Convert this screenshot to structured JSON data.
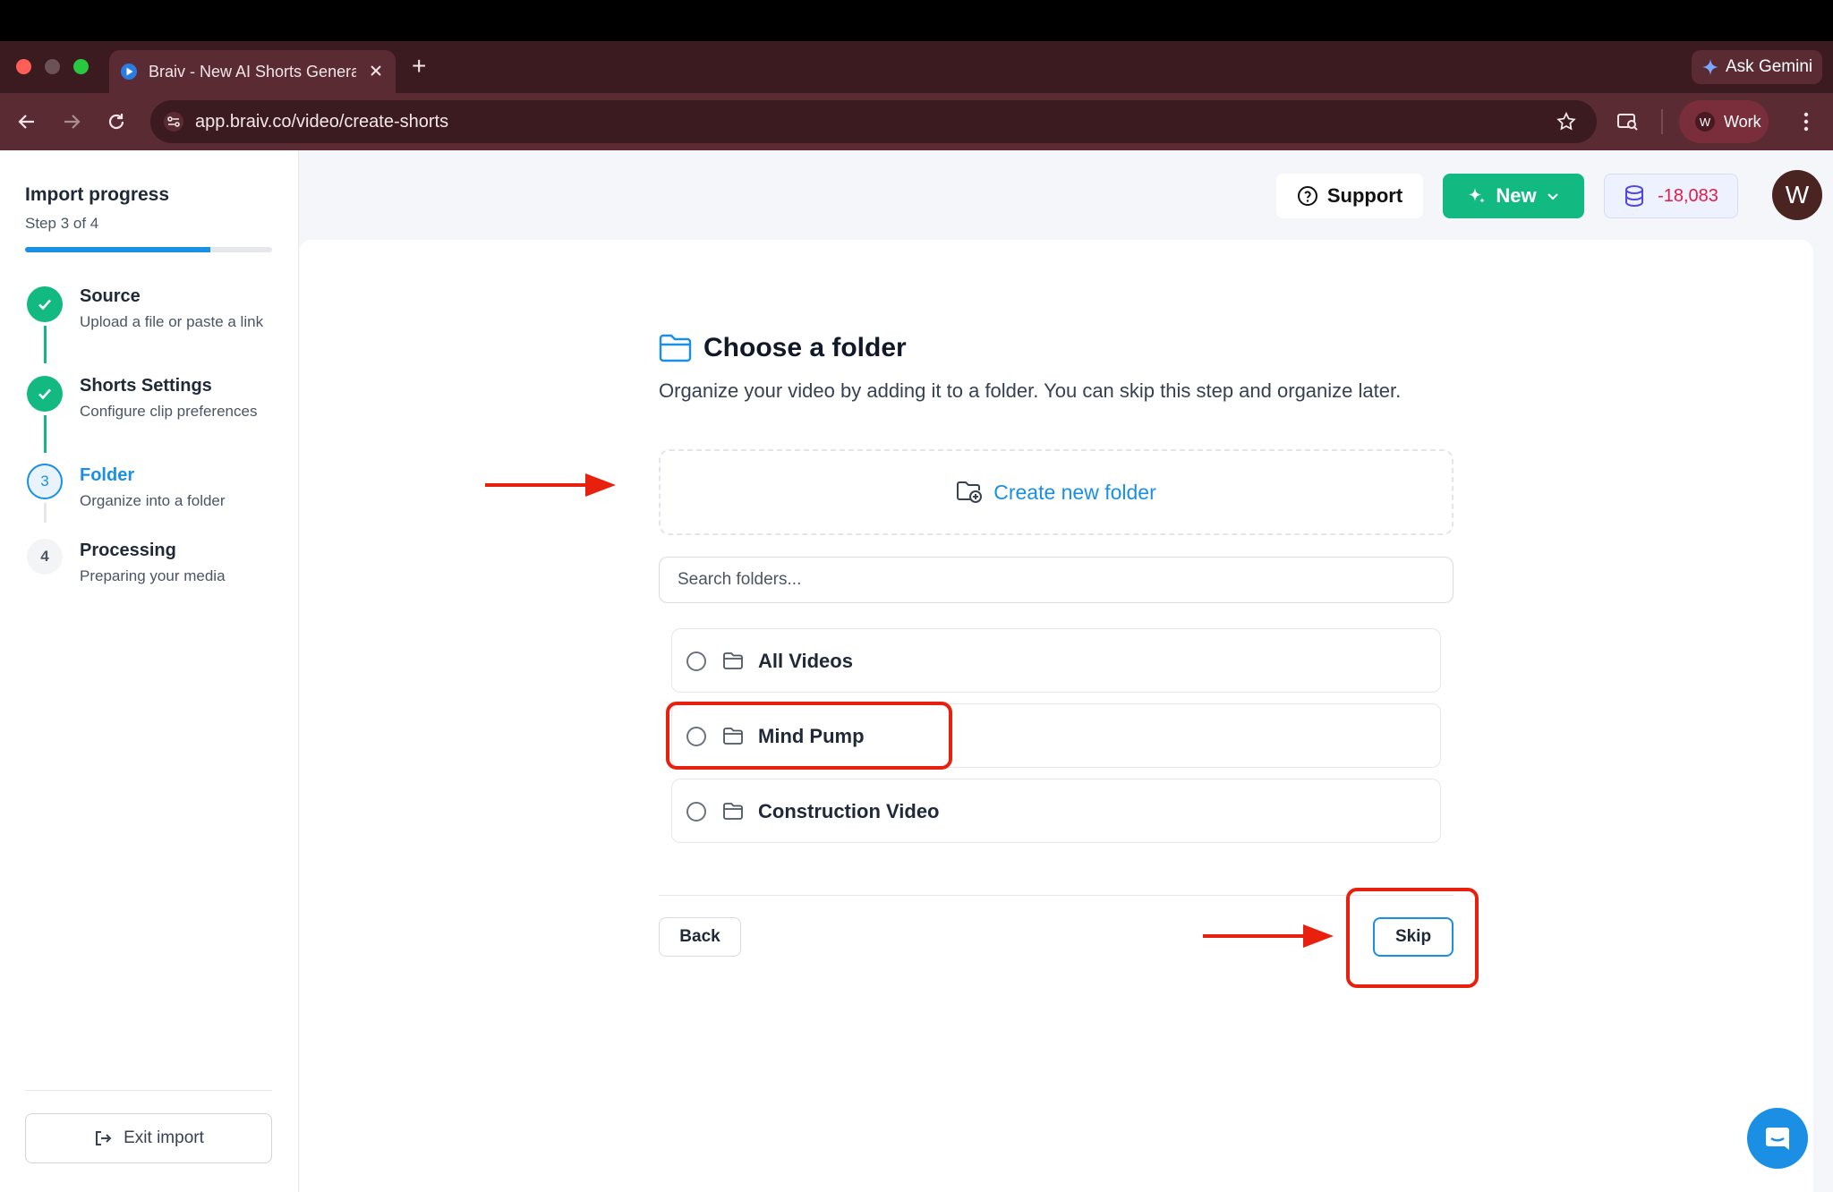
{
  "browser": {
    "tab_title": "Braiv - New AI Shorts Genera",
    "new_tab": "+",
    "ask_gemini": "Ask Gemini",
    "url": "app.braiv.co/video/create-shorts",
    "profile_initial": "W",
    "profile_label": "Work"
  },
  "sidebar": {
    "title": "Import progress",
    "step_text": "Step 3 of 4",
    "progress": 0.75,
    "steps": [
      {
        "title": "Source",
        "desc": "Upload a file or paste a link",
        "state": "done"
      },
      {
        "title": "Shorts Settings",
        "desc": "Configure clip preferences",
        "state": "done"
      },
      {
        "number": "3",
        "title": "Folder",
        "desc": "Organize into a folder",
        "state": "active"
      },
      {
        "number": "4",
        "title": "Processing",
        "desc": "Preparing your media",
        "state": "pending"
      }
    ],
    "exit_label": "Exit import"
  },
  "header": {
    "support_label": "Support",
    "new_label": "New",
    "credits": "-18,083",
    "avatar_initial": "W"
  },
  "main": {
    "heading": "Choose a folder",
    "subtitle": "Organize your video by adding it to a folder. You can skip this step and organize later.",
    "create_label": "Create new folder",
    "search_placeholder": "Search folders...",
    "folders": [
      {
        "name": "All Videos"
      },
      {
        "name": "Mind Pump"
      },
      {
        "name": "Construction Video"
      }
    ],
    "back_label": "Back",
    "skip_label": "Skip"
  },
  "colors": {
    "accent": "#1a8fe3",
    "success": "#12b981",
    "annotation": "#e8210e",
    "negative": "#e11d48"
  }
}
